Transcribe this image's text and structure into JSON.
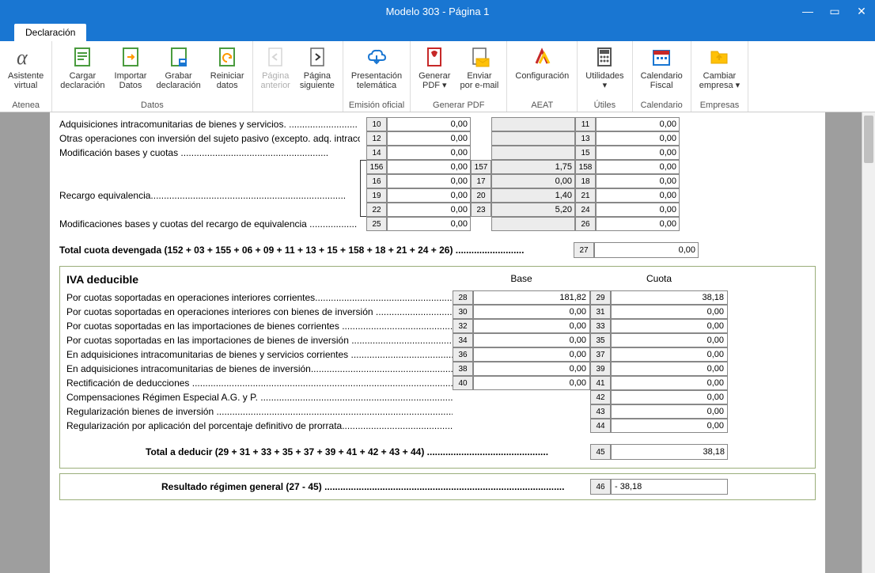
{
  "window": {
    "title": "Modelo 303 - Página 1"
  },
  "tab": {
    "label": "Declaración"
  },
  "ribbon": {
    "groups": [
      {
        "label": "Atenea",
        "items": [
          {
            "line1": "Asistente",
            "line2": "virtual",
            "icon": "alpha"
          }
        ]
      },
      {
        "label": "Datos",
        "items": [
          {
            "line1": "Cargar",
            "line2": "declaración",
            "icon": "doc-green"
          },
          {
            "line1": "Importar",
            "line2": "Datos",
            "icon": "doc-arrow"
          },
          {
            "line1": "Grabar",
            "line2": "declaración",
            "icon": "doc-disk"
          },
          {
            "line1": "Reiniciar",
            "line2": "datos",
            "icon": "doc-refresh"
          }
        ]
      },
      {
        "label": "",
        "items": [
          {
            "line1": "Página",
            "line2": "anterior",
            "icon": "page-prev",
            "disabled": true
          },
          {
            "line1": "Página",
            "line2": "siguiente",
            "icon": "page-next"
          }
        ]
      },
      {
        "label": "Emisión oficial",
        "items": [
          {
            "line1": "Presentación",
            "line2": "telemática",
            "icon": "cloud"
          }
        ]
      },
      {
        "label": "Generar PDF",
        "items": [
          {
            "line1": "Generar",
            "line2": "PDF ▾",
            "icon": "pdf"
          },
          {
            "line1": "Enviar",
            "line2": "por e-mail",
            "icon": "mail"
          }
        ]
      },
      {
        "label": "AEAT",
        "items": [
          {
            "line1": "Configuración",
            "line2": "",
            "icon": "aeat"
          }
        ]
      },
      {
        "label": "Útiles",
        "items": [
          {
            "line1": "Utilidades",
            "line2": "▾",
            "icon": "calc"
          }
        ]
      },
      {
        "label": "Calendario",
        "items": [
          {
            "line1": "Calendario",
            "line2": "Fiscal",
            "icon": "calendar"
          }
        ]
      },
      {
        "label": "Empresas",
        "items": [
          {
            "line1": "Cambiar",
            "line2": "empresa ▾",
            "icon": "folder"
          }
        ]
      }
    ]
  },
  "upper": {
    "rows": [
      {
        "label": "Adquisiciones intracomunitarias de bienes y servicios. ..........................",
        "n1": "10",
        "v1": "0,00",
        "n2": "",
        "v2": "",
        "n3": "11",
        "v3": "0,00"
      },
      {
        "label": "Otras operaciones con inversión del sujeto pasivo (excepto. adq. intracom) ...",
        "n1": "12",
        "v1": "0,00",
        "n2": "",
        "v2": "",
        "n3": "13",
        "v3": "0,00"
      },
      {
        "label": "Modificación bases y cuotas ........................................................",
        "n1": "14",
        "v1": "0,00",
        "n2": "",
        "v2": "",
        "n3": "15",
        "v3": "0,00"
      },
      {
        "label": "",
        "n1": "156",
        "v1": "0,00",
        "n2": "157",
        "v2": "1,75",
        "n3": "158",
        "v3": "0,00"
      },
      {
        "label": "",
        "n1": "16",
        "v1": "0,00",
        "n2": "17",
        "v2": "0,00",
        "n3": "18",
        "v3": "0,00"
      },
      {
        "label": "Recargo equivalencia..........................................................................",
        "n1": "19",
        "v1": "0,00",
        "n2": "20",
        "v2": "1,40",
        "n3": "21",
        "v3": "0,00"
      },
      {
        "label": "",
        "n1": "22",
        "v1": "0,00",
        "n2": "23",
        "v2": "5,20",
        "n3": "24",
        "v3": "0,00"
      },
      {
        "label": "Modificaciones bases y cuotas del recargo de equivalencia  ..................",
        "n1": "25",
        "v1": "0,00",
        "n2": "",
        "v2": "",
        "n3": "26",
        "v3": "0,00"
      }
    ],
    "total": {
      "label": "Total cuota devengada (152 + 03 + 155 + 06 + 09 + 11 + 13 + 15 + 158 + 18 + 21 + 24 + 26)  ..........................",
      "num": "27",
      "val": "0,00"
    }
  },
  "deducible": {
    "title": "IVA deducible",
    "headers": {
      "base": "Base",
      "cuota": "Cuota"
    },
    "rows": [
      {
        "label": "Por cuotas soportadas en operaciones interiores corrientes........................................................",
        "n1": "28",
        "v1": "181,82",
        "n2": "29",
        "v2": "38,18"
      },
      {
        "label": "Por cuotas soportadas en operaciones interiores con bienes de inversión .............................",
        "n1": "30",
        "v1": "0,00",
        "n2": "31",
        "v2": "0,00"
      },
      {
        "label": "Por cuotas soportadas en las importaciones de bienes corrientes ..........................................",
        "n1": "32",
        "v1": "0,00",
        "n2": "33",
        "v2": "0,00"
      },
      {
        "label": "Por cuotas soportadas en las importaciones de bienes de inversión ......................................",
        "n1": "34",
        "v1": "0,00",
        "n2": "35",
        "v2": "0,00"
      },
      {
        "label": "En adquisiciones intracomunitarias de bienes y servicios corrientes ........................................",
        "n1": "36",
        "v1": "0,00",
        "n2": "37",
        "v2": "0,00"
      },
      {
        "label": "En adquisiciones intracomunitarias de bienes de inversión.......................................................",
        "n1": "38",
        "v1": "0,00",
        "n2": "39",
        "v2": "0,00"
      },
      {
        "label": "Rectificación de deducciones ...................................................................................................",
        "n1": "40",
        "v1": "0,00",
        "n2": "41",
        "v2": "0,00"
      },
      {
        "label": "Compensaciones Régimen Especial A.G. y P. ..............................................................................................",
        "n2": "42",
        "v2": "0,00"
      },
      {
        "label": "Regularización bienes de inversión ...............................................................................................................",
        "n2": "43",
        "v2": "0,00"
      },
      {
        "label": "Regularización por aplicación del porcentaje definitivo de prorrata................................................................",
        "n2": "44",
        "v2": "0,00"
      }
    ],
    "total": {
      "label": "Total a deducir (29 + 31 + 33 + 35 + 37 + 39 + 41 + 42 + 43 + 44) ..............................................",
      "num": "45",
      "val": "38,18"
    }
  },
  "resultado": {
    "label": "Resultado régimen general (27 - 45) ...........................................................................................",
    "num": "46",
    "val": "-                       38,18"
  }
}
